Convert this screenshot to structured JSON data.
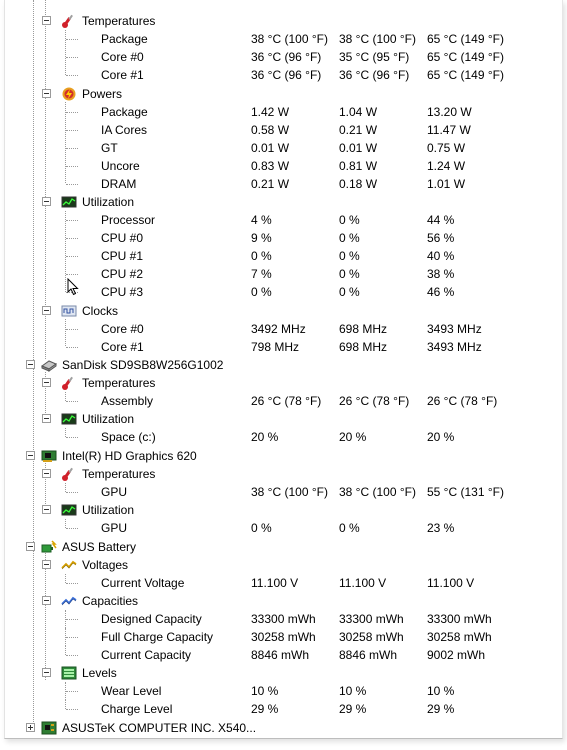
{
  "tree": {
    "top_partial": [
      {
        "name": "",
        "v1": "",
        "v2": "",
        "v3": ""
      }
    ],
    "cpu_temps": {
      "label": "Temperatures",
      "rows": [
        {
          "name": "Package",
          "v1": "38 °C  (100 °F)",
          "v2": "38 °C  (100 °F)",
          "v3": "65 °C  (149 °F)"
        },
        {
          "name": "Core #0",
          "v1": "36 °C  (96 °F)",
          "v2": "35 °C  (95 °F)",
          "v3": "65 °C  (149 °F)"
        },
        {
          "name": "Core #1",
          "v1": "36 °C  (96 °F)",
          "v2": "36 °C  (96 °F)",
          "v3": "65 °C  (149 °F)"
        }
      ]
    },
    "cpu_powers": {
      "label": "Powers",
      "rows": [
        {
          "name": "Package",
          "v1": "1.42 W",
          "v2": "1.04 W",
          "v3": "13.20 W"
        },
        {
          "name": "IA Cores",
          "v1": "0.58 W",
          "v2": "0.21 W",
          "v3": "11.47 W"
        },
        {
          "name": "GT",
          "v1": "0.01 W",
          "v2": "0.01 W",
          "v3": "0.75 W"
        },
        {
          "name": "Uncore",
          "v1": "0.83 W",
          "v2": "0.81 W",
          "v3": "1.24 W"
        },
        {
          "name": "DRAM",
          "v1": "0.21 W",
          "v2": "0.18 W",
          "v3": "1.01 W"
        }
      ]
    },
    "cpu_util": {
      "label": "Utilization",
      "rows": [
        {
          "name": "Processor",
          "v1": "4 %",
          "v2": "0 %",
          "v3": "44 %"
        },
        {
          "name": "CPU #0",
          "v1": "9 %",
          "v2": "0 %",
          "v3": "56 %"
        },
        {
          "name": "CPU #1",
          "v1": "0 %",
          "v2": "0 %",
          "v3": "40 %"
        },
        {
          "name": "CPU #2",
          "v1": "7 %",
          "v2": "0 %",
          "v3": "38 %"
        },
        {
          "name": "CPU #3",
          "v1": "0 %",
          "v2": "0 %",
          "v3": "46 %"
        }
      ]
    },
    "cpu_clocks": {
      "label": "Clocks",
      "rows": [
        {
          "name": "Core #0",
          "v1": "3492 MHz",
          "v2": "698 MHz",
          "v3": "3493 MHz"
        },
        {
          "name": "Core #1",
          "v1": "798 MHz",
          "v2": "698 MHz",
          "v3": "3493 MHz"
        }
      ]
    },
    "disk": {
      "label": "SanDisk SD9SB8W256G1002",
      "temps_label": "Temperatures",
      "temps": [
        {
          "name": "Assembly",
          "v1": "26 °C  (78 °F)",
          "v2": "26 °C  (78 °F)",
          "v3": "26 °C  (78 °F)"
        }
      ],
      "util_label": "Utilization",
      "util": [
        {
          "name": "Space (c:)",
          "v1": "20 %",
          "v2": "20 %",
          "v3": "20 %"
        }
      ]
    },
    "gpu": {
      "label": "Intel(R) HD Graphics 620",
      "temps_label": "Temperatures",
      "temps": [
        {
          "name": "GPU",
          "v1": "38 °C  (100 °F)",
          "v2": "38 °C  (100 °F)",
          "v3": "55 °C  (131 °F)"
        }
      ],
      "util_label": "Utilization",
      "util": [
        {
          "name": "GPU",
          "v1": "0 %",
          "v2": "0 %",
          "v3": "23 %"
        }
      ]
    },
    "battery": {
      "label": "ASUS Battery",
      "volt_label": "Voltages",
      "volts": [
        {
          "name": "Current Voltage",
          "v1": "11.100 V",
          "v2": "11.100 V",
          "v3": "11.100 V"
        }
      ],
      "cap_label": "Capacities",
      "caps": [
        {
          "name": "Designed Capacity",
          "v1": "33300 mWh",
          "v2": "33300 mWh",
          "v3": "33300 mWh"
        },
        {
          "name": "Full Charge Capacity",
          "v1": "30258 mWh",
          "v2": "30258 mWh",
          "v3": "30258 mWh"
        },
        {
          "name": "Current Capacity",
          "v1": "8846 mWh",
          "v2": "8846 mWh",
          "v3": "9002 mWh"
        }
      ],
      "lvl_label": "Levels",
      "levels": [
        {
          "name": "Wear Level",
          "v1": "10 %",
          "v2": "10 %",
          "v3": "10 %"
        },
        {
          "name": "Charge Level",
          "v1": "29 %",
          "v2": "29 %",
          "v3": "29 %"
        }
      ]
    },
    "mobo": {
      "label": "ASUSTeK COMPUTER INC. X540..."
    }
  }
}
